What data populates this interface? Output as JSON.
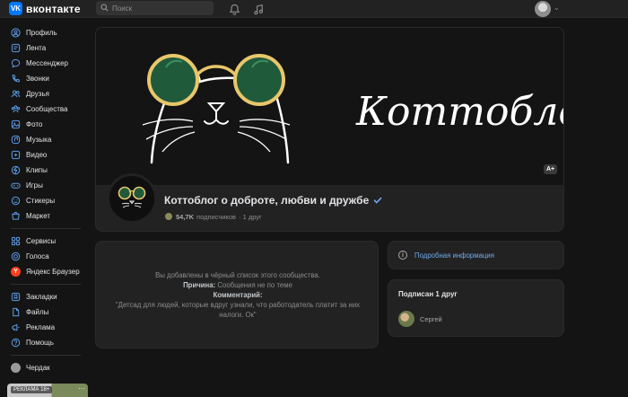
{
  "topbar": {
    "logo_mark": "VK",
    "logo_text": "вконтакте",
    "search_placeholder": "Поиск"
  },
  "sidebar": {
    "items": [
      {
        "label": "Профиль",
        "icon": "profile-icon"
      },
      {
        "label": "Лента",
        "icon": "feed-icon"
      },
      {
        "label": "Мессенджер",
        "icon": "messenger-icon"
      },
      {
        "label": "Звонки",
        "icon": "phone-icon"
      },
      {
        "label": "Друзья",
        "icon": "friends-icon"
      },
      {
        "label": "Сообщества",
        "icon": "communities-icon"
      },
      {
        "label": "Фото",
        "icon": "photo-icon"
      },
      {
        "label": "Музыка",
        "icon": "music-icon"
      },
      {
        "label": "Видео",
        "icon": "video-icon"
      },
      {
        "label": "Клипы",
        "icon": "clips-icon"
      },
      {
        "label": "Игры",
        "icon": "games-icon"
      },
      {
        "label": "Стикеры",
        "icon": "stickers-icon"
      },
      {
        "label": "Маркет",
        "icon": "market-icon"
      }
    ],
    "items2": [
      {
        "label": "Сервисы",
        "icon": "services-icon"
      },
      {
        "label": "Голоса",
        "icon": "votes-icon"
      },
      {
        "label": "Яндекс Браузер",
        "icon": "yandex-icon"
      }
    ],
    "items3": [
      {
        "label": "Закладки",
        "icon": "bookmarks-icon"
      },
      {
        "label": "Файлы",
        "icon": "files-icon"
      },
      {
        "label": "Реклама",
        "icon": "ads-icon"
      },
      {
        "label": "Помощь",
        "icon": "help-icon"
      }
    ],
    "chat": {
      "label": "Чердак"
    },
    "ad_label": "РЕКЛАМА 18+"
  },
  "group": {
    "cover_title": "Коттоблог",
    "a_plus": "A+",
    "name": "Коттоблог о доброте, любви и дружбе",
    "subscribers": "54,7K",
    "subscribers_suffix": "подписчиков",
    "friends_count": "· 1 друг"
  },
  "blocked": {
    "line1": "Вы добавлены в чёрный список этого сообщества.",
    "reason_label": "Причина:",
    "reason_value": "Сообщения не по теме",
    "comment_label": "Комментарий:",
    "comment_value": "\"Детсад для людей, которые вдруг узнали, что работодатель платит за них налоги. Ок\""
  },
  "info": {
    "link": "Подробная информация"
  },
  "friends": {
    "title": "Подписан 1 друг",
    "list": [
      {
        "name": "Сергей"
      }
    ]
  },
  "colors": {
    "accent": "#71aaeb",
    "brand": "#0077ff",
    "background": "#141414",
    "card": "#222222"
  }
}
